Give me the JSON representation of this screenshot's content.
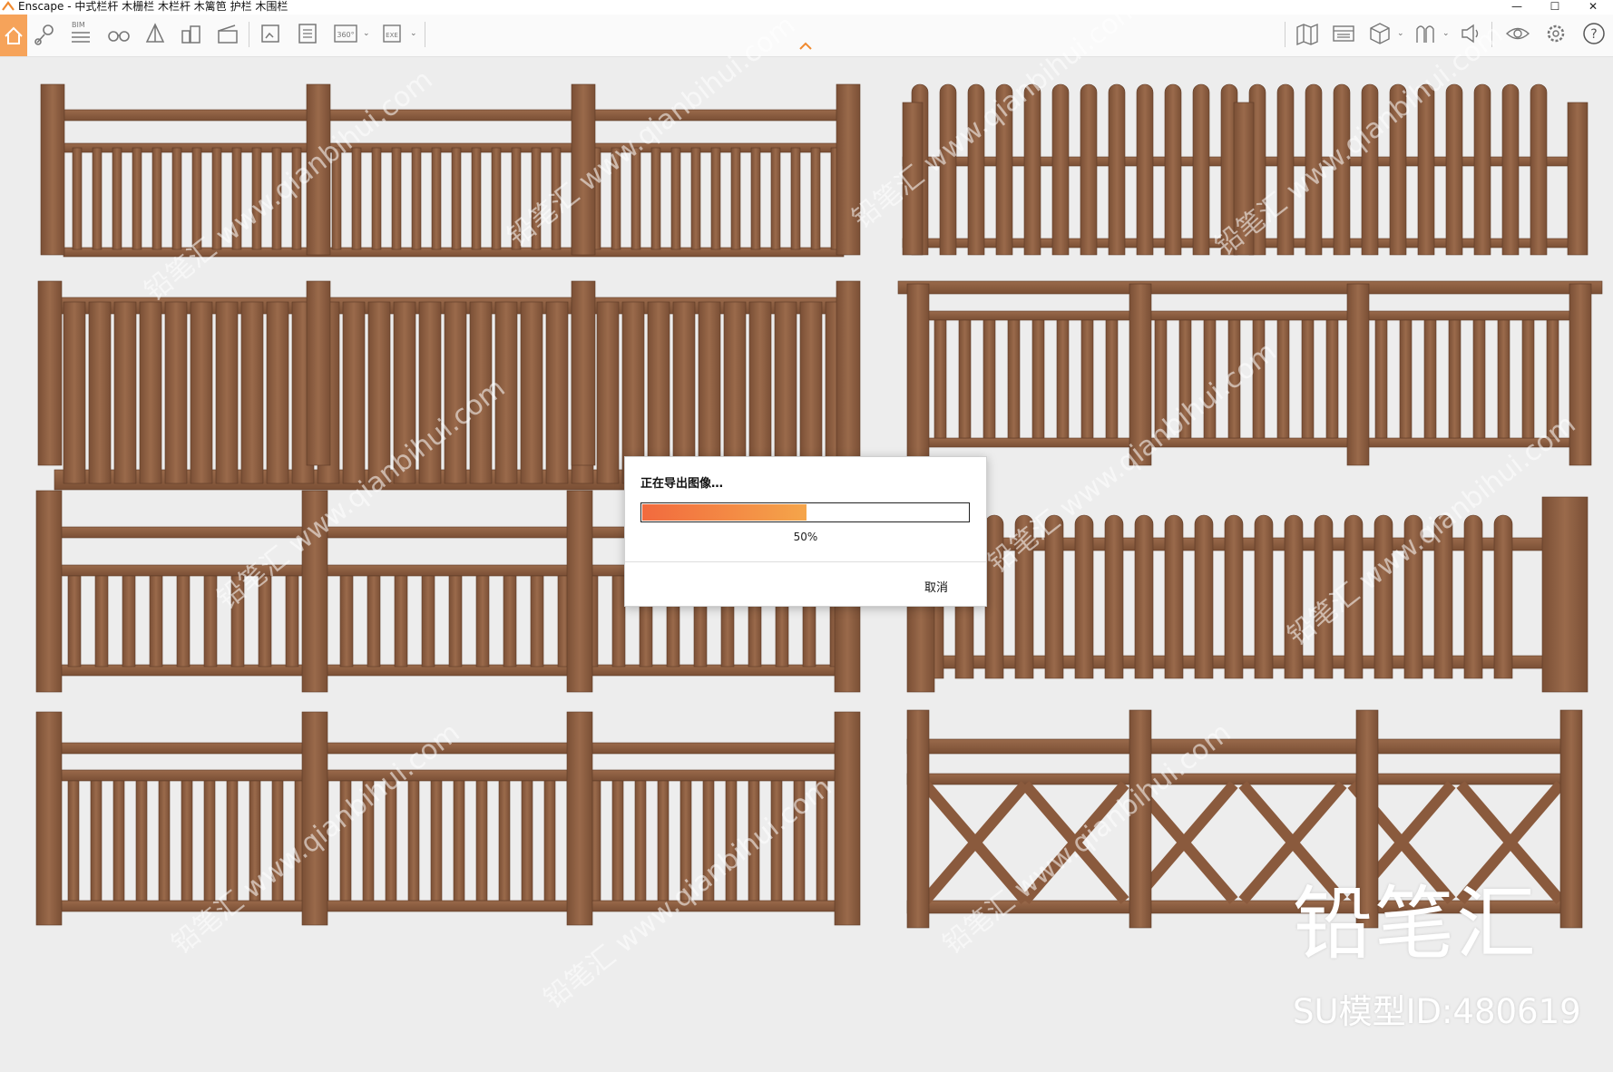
{
  "window": {
    "title": "Enscape - 中式栏杆 木栅栏 木栏杆 木篱笆 护栏 木围栏",
    "controls": {
      "minimize": "—",
      "maximize": "☐",
      "close": "✕"
    }
  },
  "toolbar": {
    "bim_label": "BIM",
    "caret": "⌄",
    "left_tools": [
      {
        "name": "home-icon"
      },
      {
        "name": "location-icon"
      },
      {
        "name": "bim-list-icon"
      },
      {
        "name": "binoculars-icon"
      },
      {
        "name": "perspective-icon"
      },
      {
        "name": "buildings-icon"
      },
      {
        "name": "clapper-icon"
      },
      {
        "name": "export-image-icon"
      },
      {
        "name": "batch-export-icon"
      },
      {
        "name": "panorama-360-icon"
      },
      {
        "name": "exe-export-icon"
      }
    ],
    "panorama_label": "360°",
    "exe_label": "EXE",
    "right_tools": [
      {
        "name": "map-icon"
      },
      {
        "name": "panel-icon"
      },
      {
        "name": "cube-icon"
      },
      {
        "name": "materials-icon"
      },
      {
        "name": "speaker-icon"
      },
      {
        "name": "eye-icon"
      },
      {
        "name": "settings-icon"
      },
      {
        "name": "help-icon"
      }
    ]
  },
  "dialog": {
    "title": "正在导出图像…",
    "progress": 0.5,
    "progress_label": "50%",
    "cancel_label": "取消"
  },
  "watermark": {
    "brand": "铅笔汇",
    "model_id": "SU模型ID:480619",
    "tile_text": "铅笔汇 www.qianbihui.com"
  },
  "colors": {
    "accent": "#f6a35a",
    "progress_start": "#f26a3e",
    "progress_end": "#f5a54a",
    "wood": "#8a5a3d",
    "wood_dark": "#6f4630"
  }
}
